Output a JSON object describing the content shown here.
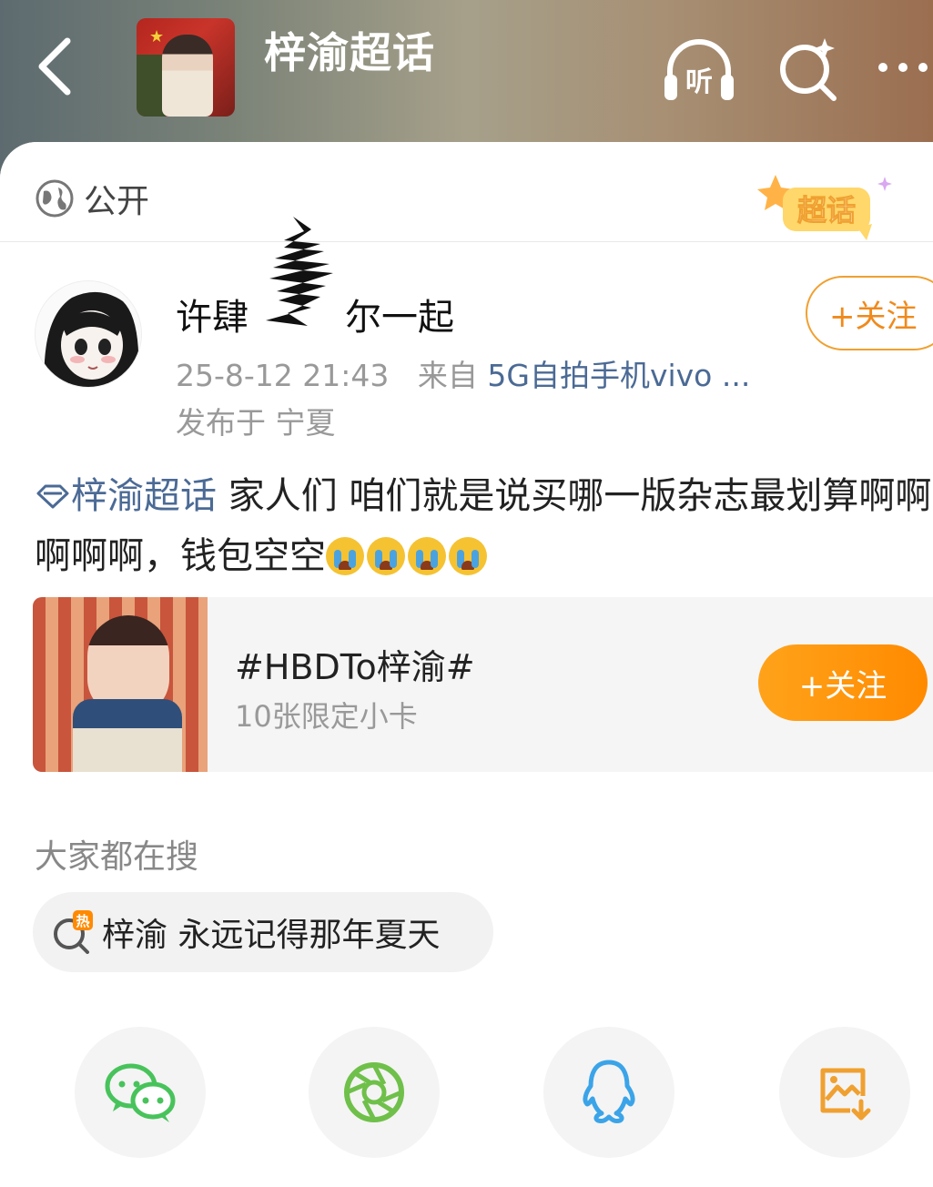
{
  "header": {
    "title": "梓渝超话",
    "listen_label": "听"
  },
  "visibility": {
    "label": "公开"
  },
  "badge": {
    "label": "超话"
  },
  "author": {
    "name_prefix": "许肆",
    "name_suffix": "尔一起",
    "timestamp": "25-8-12 21:43",
    "source_prefix": "来自",
    "device": "5G自拍手机vivo ...",
    "location": "发布于 宁夏",
    "follow_label": "+关注"
  },
  "post": {
    "topic_link": "梓渝超话",
    "text": " 家人们 咱们就是说买哪一版杂志最划算啊啊啊啊啊，钱包空空",
    "emoji_count": 4
  },
  "topic_card": {
    "title": "#HBDTo梓渝#",
    "subtitle": "10张限定小卡",
    "follow_label": "+关注"
  },
  "search": {
    "heading": "大家都在搜",
    "hot_badge": "热",
    "query": "梓渝 永远记得那年夏天"
  },
  "share": {
    "items": [
      "wechat",
      "moments",
      "qq",
      "save-image"
    ]
  },
  "colors": {
    "accent_orange": "#ff8a00",
    "link_blue": "#4b6a95",
    "wechat_green": "#48c35b",
    "qq_blue": "#3ba4e8"
  }
}
